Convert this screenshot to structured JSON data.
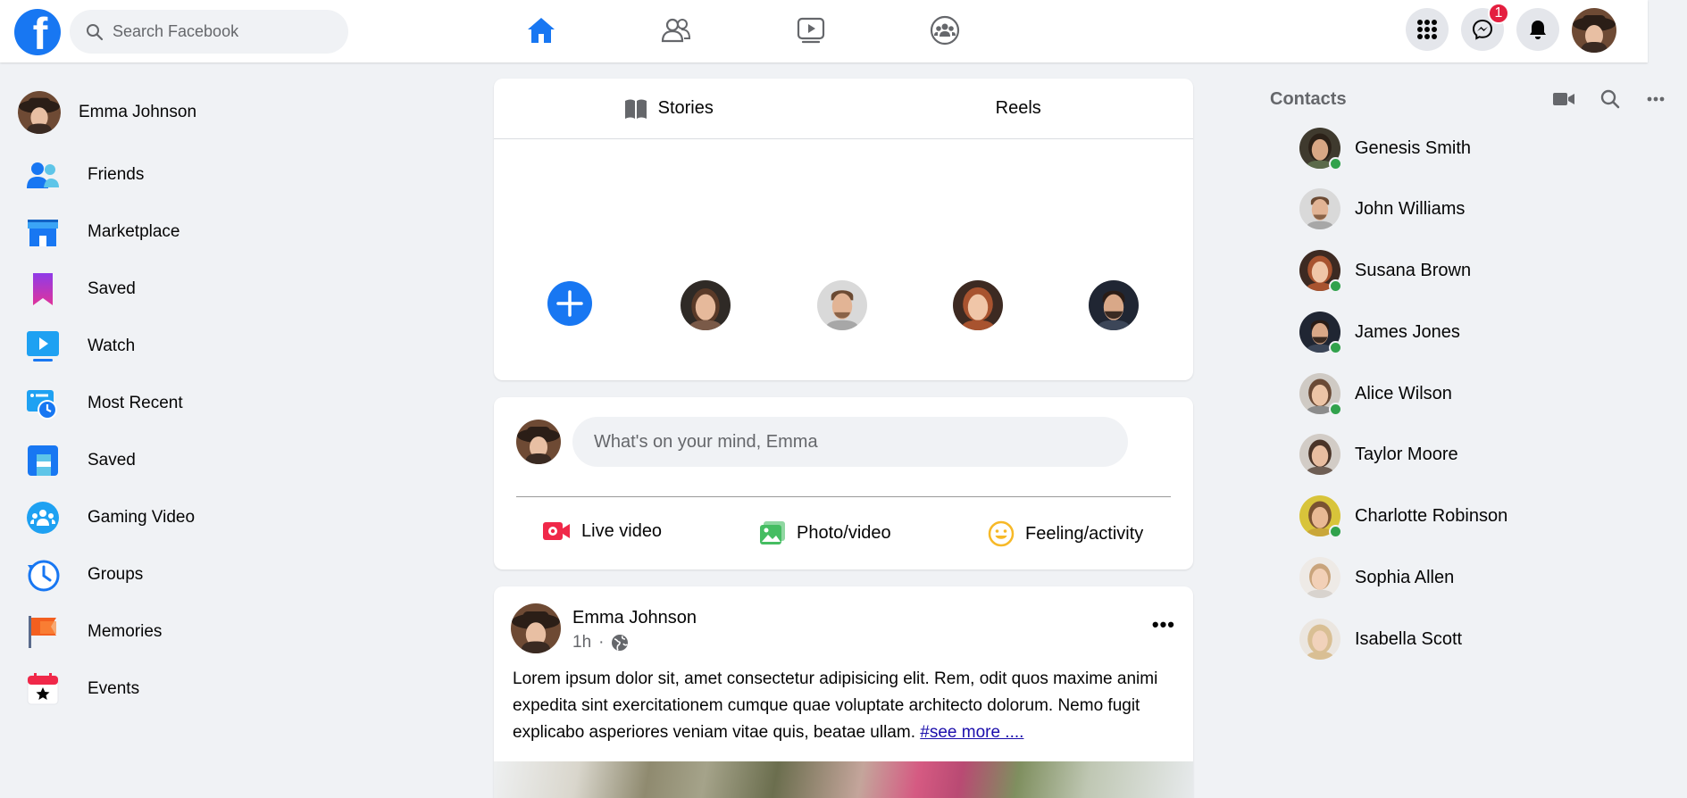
{
  "header": {
    "logo_letter": "f",
    "search_placeholder": "Search Facebook",
    "nav": [
      "home-icon",
      "friends-icon",
      "watch-icon",
      "groups-icon"
    ],
    "messenger_badge": "1",
    "accent_color": "#1877f2"
  },
  "left_sidebar": {
    "profile_name": "Emma Johnson",
    "items": [
      {
        "label": "Friends",
        "icon": "friends-icon"
      },
      {
        "label": "Marketplace",
        "icon": "marketplace-icon"
      },
      {
        "label": "Saved",
        "icon": "bookmark-icon"
      },
      {
        "label": "Watch",
        "icon": "watch-icon"
      },
      {
        "label": "Most Recent",
        "icon": "most-recent-icon"
      },
      {
        "label": "Saved",
        "icon": "saved-feed-icon"
      },
      {
        "label": "Gaming Video",
        "icon": "gaming-video-icon"
      },
      {
        "label": "Groups",
        "icon": "groups-clock-icon"
      },
      {
        "label": "Memories",
        "icon": "memories-icon"
      },
      {
        "label": "Events",
        "icon": "events-icon"
      }
    ]
  },
  "stories": {
    "tabs": [
      "Stories",
      "Reels"
    ]
  },
  "composer": {
    "placeholder": "What's on your mind, Emma",
    "actions": [
      {
        "label": "Live video",
        "icon": "live-video-icon"
      },
      {
        "label": "Photo/video",
        "icon": "photo-icon"
      },
      {
        "label": "Feeling/activity",
        "icon": "feeling-icon"
      }
    ]
  },
  "post": {
    "author": "Emma Johnson",
    "time": "1h",
    "separator": "·",
    "more": "•••",
    "text": "Lorem ipsum dolor sit, amet consectetur adipisicing elit. Rem, odit quos maxime animi expedita sint exercitationem cumque quae voluptate architecto dolorum. Nemo fugit explicabo asperiores veniam vitae quis, beatae ullam.",
    "see_more": "#see more ...."
  },
  "contacts": {
    "title": "Contacts",
    "list": [
      {
        "name": "Genesis Smith",
        "online": true
      },
      {
        "name": "John Williams",
        "online": false
      },
      {
        "name": "Susana Brown",
        "online": true
      },
      {
        "name": "James Jones",
        "online": true
      },
      {
        "name": "Alice Wilson",
        "online": true
      },
      {
        "name": "Taylor Moore",
        "online": false
      },
      {
        "name": "Charlotte Robinson",
        "online": true
      },
      {
        "name": "Sophia Allen",
        "online": false
      },
      {
        "name": "Isabella Scott",
        "online": false
      }
    ]
  }
}
